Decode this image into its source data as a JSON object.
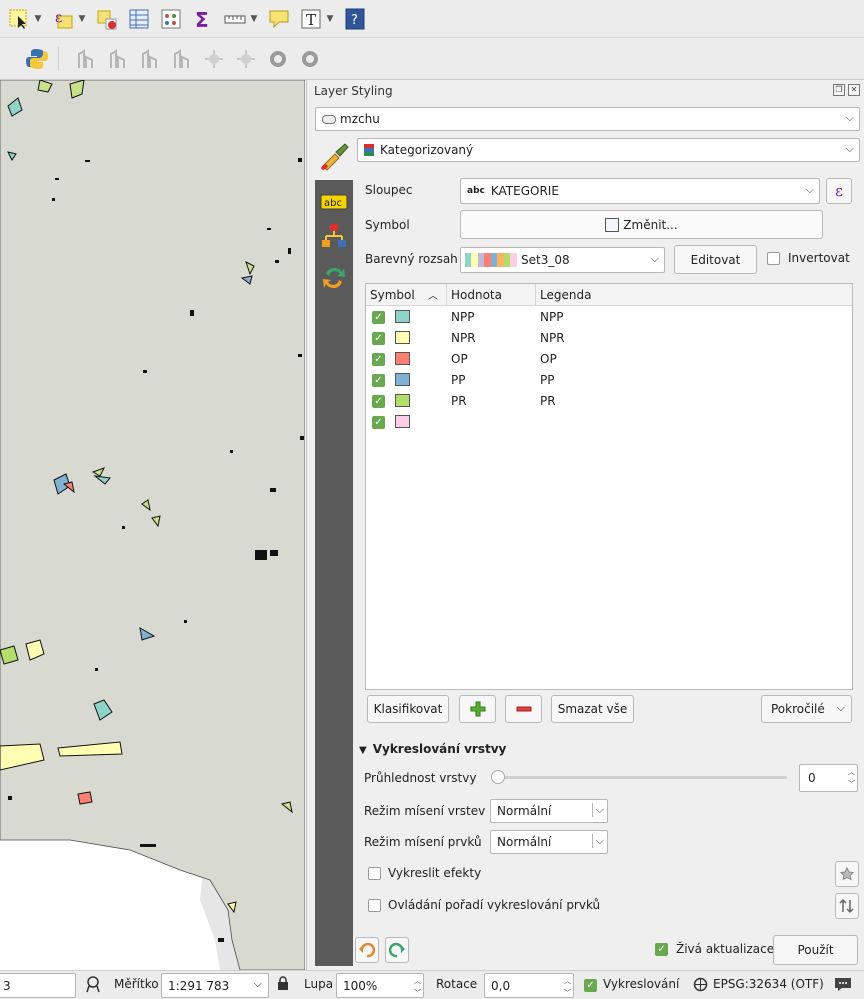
{
  "toolbar": {
    "icons_row1": [
      "select-feature-icon",
      "expression-select-icon",
      "deselect-icon",
      "attribute-table-icon",
      "field-calculator-icon",
      "statistics-icon",
      "measure-icon",
      "map-tips-icon",
      "text-annotation-icon",
      "help-icon"
    ],
    "icons_row2": [
      "python-icon",
      "digitize-tool-icons"
    ]
  },
  "dock": {
    "title": "Layer Styling",
    "layer_combo": "mzchu",
    "renderer_combo": "Kategorizovaný",
    "column_label": "Sloupec",
    "column_value": "KATEGORIE",
    "column_type_badge": "abc",
    "expression_button": "ε",
    "symbol_label": "Symbol",
    "symbol_button": "Změnit...",
    "ramp_label": "Barevný rozsah",
    "ramp_value": "Set3_08",
    "edit_button": "Editovat",
    "invert_label": "Invertovat",
    "table_headers": {
      "symbol": "Symbol",
      "value": "Hodnota",
      "legend": "Legenda"
    },
    "categories": [
      {
        "value": "NPP",
        "legend": "NPP",
        "color": "#8dd3c7"
      },
      {
        "value": "NPR",
        "legend": "NPR",
        "color": "#ffffb3"
      },
      {
        "value": "OP",
        "legend": "OP",
        "color": "#fb8072"
      },
      {
        "value": "PP",
        "legend": "PP",
        "color": "#80b1d3"
      },
      {
        "value": "PR",
        "legend": "PR",
        "color": "#b3de69"
      },
      {
        "value": "",
        "legend": "",
        "color": "#fccde5"
      }
    ],
    "classify_button": "Klasifikovat",
    "delete_all_button": "Smazat vše",
    "advanced_button": "Pokročilé",
    "section_title": "Vykreslování vrstvy",
    "opacity_label": "Průhlednost vrstvy",
    "opacity_value": "0",
    "layer_blend_label": "Režim mísení vrstev",
    "layer_blend_value": "Normální",
    "feature_blend_label": "Režim mísení prvků",
    "feature_blend_value": "Normální",
    "draw_effects_label": "Vykreslit efekty",
    "order_label": "Ovládání pořadí vykreslování prvků",
    "live_update_label": "Živá aktualizace",
    "apply_button": "Použít"
  },
  "status": {
    "coord_tail": "3",
    "scale_label": "Měřítko",
    "scale_value": "1:291 783",
    "magnifier_label": "Lupa",
    "magnifier_value": "100%",
    "rotation_label": "Rotace",
    "rotation_value": "0,0",
    "render_label": "Vykreslování",
    "crs_label": "EPSG:32634 (OTF)"
  }
}
